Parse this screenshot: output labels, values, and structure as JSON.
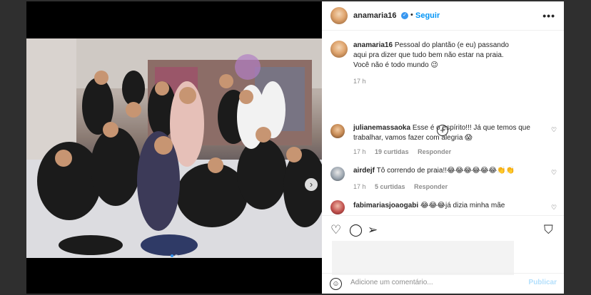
{
  "header": {
    "username": "anamaria16",
    "follow_label": "Seguir",
    "menu_icon": "more-horizontal-icon"
  },
  "caption": {
    "username": "anamaria16",
    "text": "Pessoal do plantão (e eu) passando aqui pra dizer que tudo bem não estar na praia.",
    "text2": "Você não é todo mundo 😉",
    "time": "17 h"
  },
  "comments": [
    {
      "username": "julianemassaoka",
      "text": "Esse é o espírito!!! Já que temos que trabalhar, vamos fazer com alegria 😱",
      "time": "17 h",
      "likes": "19 curtidas",
      "reply": "Responder"
    },
    {
      "username": "airdejf",
      "text": "Tô correndo de praia!!😂😂😂😂😂😂👏👏",
      "time": "17 h",
      "likes": "5 curtidas",
      "reply": "Responder"
    },
    {
      "username": "fabimariasjoaogabi",
      "text": "😂😂😂já dizia minha mãe"
    }
  ],
  "add_comment": {
    "placeholder": "Adicione um comentário...",
    "publish_label": "Publicar"
  },
  "colors": {
    "accent": "#0095f6",
    "verified": "#3897f0"
  }
}
